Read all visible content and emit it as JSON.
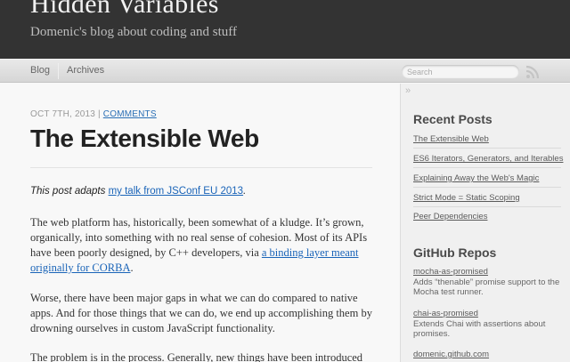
{
  "header": {
    "title": "Hidden Variables",
    "subtitle": "Domenic's blog about coding and stuff"
  },
  "nav": {
    "items": [
      "Blog",
      "Archives"
    ],
    "search_placeholder": "Search",
    "rss_icon": "rss-icon"
  },
  "post": {
    "date": "OCT 7TH, 2013",
    "separator": "|",
    "comments_label": "COMMENTS",
    "title": "The Extensible Web",
    "intro_text": "This post adapts ",
    "intro_link": "my talk from JSConf EU 2013",
    "intro_end": ".",
    "p1_text": "The web platform has, historically, been somewhat of a kludge. It’s grown, organically, into something with no real sense of cohesion. Most of its APIs have been poorly designed, by C++ developers, via ",
    "p1_link": "a binding layer meant originally for CORBA",
    "p1_end": ".",
    "p2": "Worse, there have been major gaps in what we can do compared to native apps. And for those things that we can do, we end up accomplishing them by drowning ourselves in custom JavaScript functionality.",
    "p3": "The problem is in the process. Generally, new things have been introduced"
  },
  "sidebar": {
    "collapse_glyph": "»",
    "recent_heading": "Recent Posts",
    "recent_posts": [
      "The Extensible Web",
      "ES6 Iterators, Generators, and Iterables",
      "Explaining Away the Web's Magic",
      "Strict Mode = Static Scoping",
      "Peer Dependencies"
    ],
    "repos_heading": "GitHub Repos",
    "repos": [
      {
        "name": "mocha-as-promised",
        "desc": "Adds “thenable” promise support to the Mocha test runner."
      },
      {
        "name": "chai-as-promised",
        "desc": "Extends Chai with assertions about promises."
      },
      {
        "name": "domenic.github.com",
        "desc": ""
      }
    ]
  },
  "colors": {
    "header_bg": "#333333",
    "link": "#1a64b8",
    "sidebar_bg": "#f0f0f0"
  }
}
